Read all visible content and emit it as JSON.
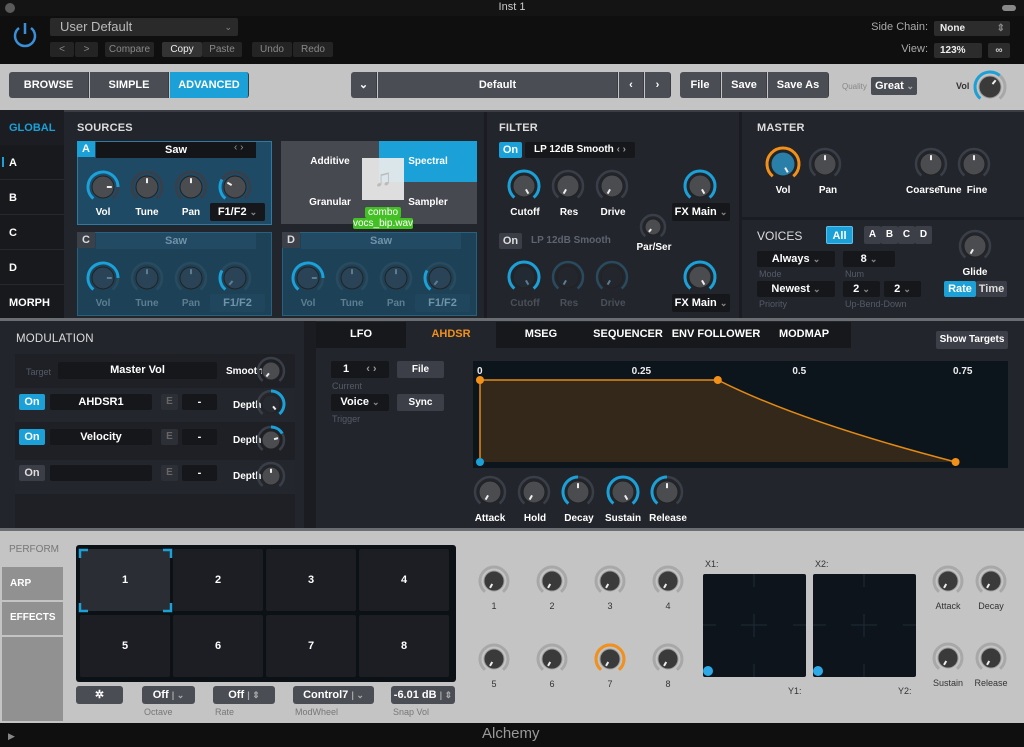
{
  "window": {
    "title": "Inst 1"
  },
  "header": {
    "preset": "User Default",
    "prev_label": "<",
    "next_label": ">",
    "compare": "Compare",
    "copy": "Copy",
    "paste": "Paste",
    "undo": "Undo",
    "redo": "Redo",
    "side_chain_label": "Side Chain:",
    "side_chain_value": "None",
    "view_label": "View:",
    "view_value": "123%"
  },
  "toolbar": {
    "browse": "BROWSE",
    "simple": "SIMPLE",
    "advanced": "ADVANCED",
    "preset_name": "Default",
    "file": "File",
    "save": "Save",
    "save_as": "Save As",
    "quality_label": "Quality",
    "quality_value": "Great",
    "vol_label": "Vol",
    "accent": "#1ba1d8"
  },
  "sidebar": {
    "global": "GLOBAL",
    "items": [
      {
        "label": "A"
      },
      {
        "label": "B"
      },
      {
        "label": "C"
      },
      {
        "label": "D"
      },
      {
        "label": "MORPH"
      }
    ]
  },
  "sources": {
    "title": "SOURCES",
    "a": {
      "label": "A",
      "name": "Saw",
      "knobs": [
        "Vol",
        "Tune",
        "Pan"
      ],
      "filter_route": "F1/F2"
    },
    "c": {
      "label": "C",
      "name": "Saw",
      "knobs": [
        "Vol",
        "Tune",
        "Pan"
      ],
      "filter_route": "F1/F2"
    },
    "d": {
      "label": "D",
      "name": "Saw",
      "knobs": [
        "Vol",
        "Tune",
        "Pan"
      ],
      "filter_route": "F1/F2"
    },
    "engines": [
      "Additive",
      "Spectral",
      "Granular",
      "Sampler"
    ],
    "drag_tag_line1": "combo",
    "drag_tag_line2": "vocs_bip.wav"
  },
  "filter": {
    "title": "FILTER",
    "f1": {
      "on": "On",
      "type": "LP 12dB Smooth",
      "knobs": [
        "Cutoff",
        "Res",
        "Drive"
      ],
      "route": "FX Main"
    },
    "f2": {
      "on": "On",
      "type": "LP 12dB Smooth",
      "knobs": [
        "Cutoff",
        "Res",
        "Drive"
      ],
      "route": "FX Main"
    },
    "par_ser": "Par/Ser"
  },
  "master": {
    "title": "MASTER",
    "knobs": [
      "Vol",
      "Pan",
      "Coarse",
      "Tune",
      "Fine"
    ]
  },
  "voices": {
    "title": "VOICES",
    "all": "All",
    "sources": [
      "A",
      "B",
      "C",
      "D"
    ],
    "mode_value": "Always",
    "mode_label": "Mode",
    "num_value": "8",
    "num_label": "Num",
    "priority_value": "Newest",
    "priority_label": "Priority",
    "bend_up": "2",
    "bend_down": "2",
    "bend_label": "Up-Bend-Down",
    "glide": "Glide",
    "rate": "Rate",
    "time": "Time"
  },
  "modulation": {
    "title": "MODULATION",
    "target_label": "Target",
    "target_value": "Master Vol",
    "smooth_label": "Smooth",
    "rows": [
      {
        "on": "On",
        "source": "AHDSR1",
        "e": "E",
        "via": "-",
        "depth": "Depth",
        "active": true
      },
      {
        "on": "On",
        "source": "Velocity",
        "e": "E",
        "via": "-",
        "depth": "Depth",
        "active": true
      },
      {
        "on": "On",
        "source": "",
        "e": "E",
        "via": "-",
        "depth": "Depth",
        "active": false
      }
    ]
  },
  "mod_tabs": [
    "LFO",
    "AHDSR",
    "MSEG",
    "SEQUENCER",
    "ENV FOLLOWER",
    "MODMAP"
  ],
  "show_targets": "Show Targets",
  "ahdsr": {
    "current_value": "1",
    "current_label": "Current",
    "file": "File",
    "trigger_value": "Voice",
    "trigger_label": "Trigger",
    "sync": "Sync",
    "knobs": [
      "Attack",
      "Hold",
      "Decay",
      "Sustain",
      "Release"
    ],
    "ruler": [
      "0",
      "0.25",
      "0.5",
      "0.75"
    ],
    "envelope_points": [
      [
        0,
        0
      ],
      [
        0,
        1
      ],
      [
        0.37,
        1
      ],
      [
        0.74,
        0
      ]
    ]
  },
  "perform": {
    "tabs": [
      "PERFORM",
      "ARP",
      "EFFECTS"
    ],
    "pads": [
      "1",
      "2",
      "3",
      "4",
      "5",
      "6",
      "7",
      "8"
    ],
    "octave_value": "Off",
    "octave_label": "Octave",
    "rate_value": "Off",
    "rate_label": "Rate",
    "modwheel_value": "Control7",
    "modwheel_label": "ModWheel",
    "snapvol_value": "-6.01 dB",
    "snapvol_label": "Snap Vol",
    "knobs": [
      "1",
      "2",
      "3",
      "4",
      "5",
      "6",
      "7",
      "8"
    ],
    "x1": "X1:",
    "y1": "Y1:",
    "x2": "X2:",
    "y2": "Y2:",
    "env_knobs": [
      "Attack",
      "Decay",
      "Sustain",
      "Release"
    ]
  },
  "footer": {
    "plugin_name": "Alchemy"
  }
}
